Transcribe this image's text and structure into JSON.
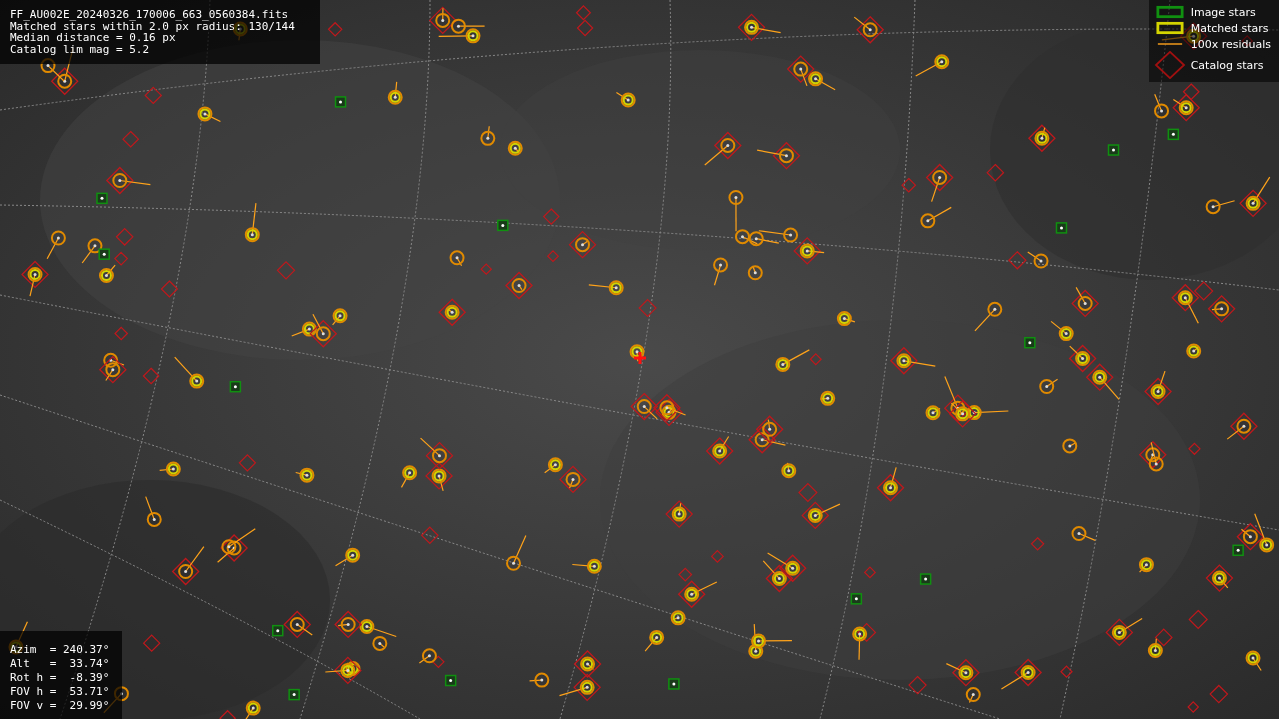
{
  "info_top": {
    "lines": [
      "FF_AU002E_20240326_170006_663_0560384.fits",
      "Matched stars within 2.0 px radius: 130/144",
      "Median distance = 0.16 px",
      "Catalog lim mag = 5.2"
    ]
  },
  "legend": [
    {
      "kind": "image",
      "label": "Image stars"
    },
    {
      "kind": "matched",
      "label": "Matched stars"
    },
    {
      "kind": "residual",
      "label": "100x residuals"
    },
    {
      "kind": "catalog",
      "label": "Catalog stars"
    }
  ],
  "info_bottom": {
    "lines": [
      "Azim  = 240.37°",
      "Alt   =  33.74°",
      "Rot h =  -8.39°",
      "FOV h =  53.71°",
      "FOV v =  29.99°"
    ]
  }
}
